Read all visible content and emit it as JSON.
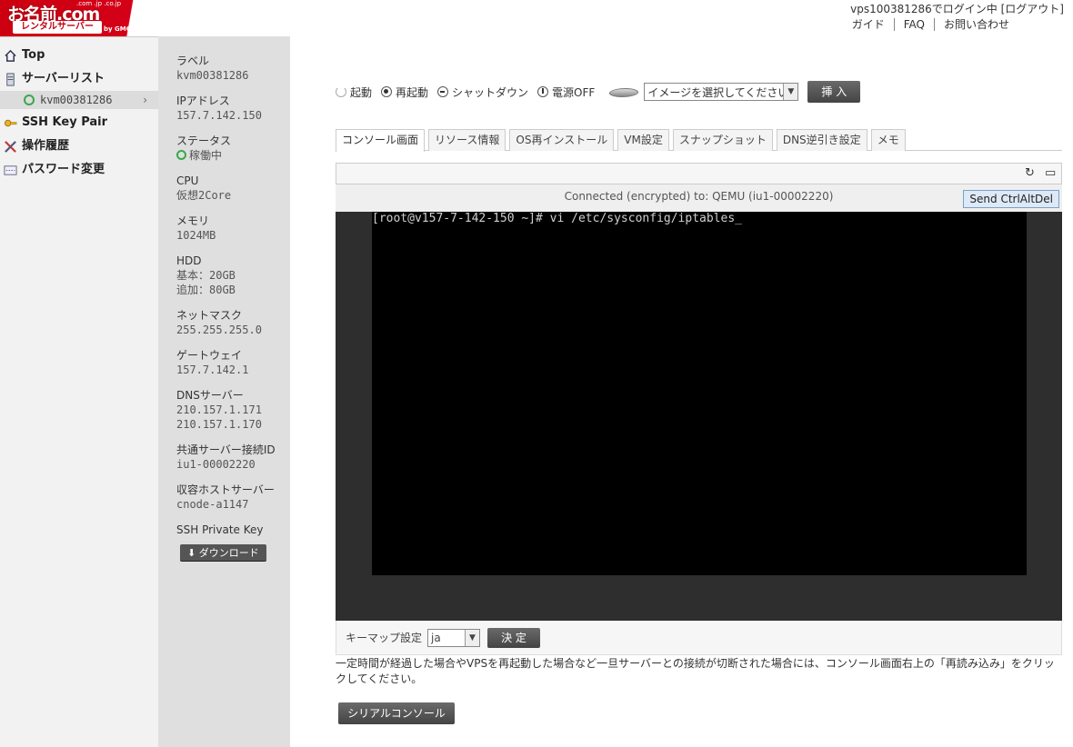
{
  "header": {
    "logo_main": "お名前.com",
    "logo_sub": "レンタルサーバー",
    "logo_by": "by GMO",
    "logo_domains": ".com .jp .co.jp",
    "login_status": "vps100381286でログイン中 [ログアウト]",
    "links": [
      "ガイド",
      "FAQ",
      "お問い合わせ"
    ]
  },
  "sidebar": {
    "items": [
      {
        "label": "Top",
        "icon": "home-icon"
      },
      {
        "label": "サーバーリスト",
        "icon": "server-icon"
      },
      {
        "label": "SSH Key Pair",
        "icon": "key-icon"
      },
      {
        "label": "操作履歴",
        "icon": "tools-icon"
      },
      {
        "label": "パスワード変更",
        "icon": "password-icon"
      }
    ],
    "server_entry": "kvm00381286"
  },
  "info": {
    "label_k": "ラベル",
    "label_v": "kvm00381286",
    "ip_k": "IPアドレス",
    "ip_v": "157.7.142.150",
    "status_k": "ステータス",
    "status_v": "稼働中",
    "cpu_k": "CPU",
    "cpu_v": "仮想2Core",
    "mem_k": "メモリ",
    "mem_v": "1024MB",
    "hdd_k": "HDD",
    "hdd_v1": "基本：20GB",
    "hdd_v2": "追加：80GB",
    "mask_k": "ネットマスク",
    "mask_v": "255.255.255.0",
    "gw_k": "ゲートウェイ",
    "gw_v": "157.7.142.1",
    "dns_k": "DNSサーバー",
    "dns_v1": "210.157.1.171",
    "dns_v2": "210.157.1.170",
    "shared_k": "共通サーバー接続ID",
    "shared_v": "iu1-00002220",
    "host_k": "収容ホストサーバー",
    "host_v": "cnode-a1147",
    "ssh_k": "SSH Private Key",
    "download": "ダウンロード"
  },
  "controls": {
    "start": "起動",
    "restart": "再起動",
    "shutdown": "シャットダウン",
    "poweroff": "電源OFF",
    "image_select": "イメージを選択してください",
    "insert": "挿 入"
  },
  "tabs": [
    "コンソール画面",
    "リソース情報",
    "OS再インストール",
    "VM設定",
    "スナップショット",
    "DNS逆引き設定",
    "メモ"
  ],
  "console": {
    "status": "Connected (encrypted) to: QEMU (iu1-00002220)",
    "send_cad": "Send CtrlAltDel",
    "terminal_line": "[root@v157-7-142-150 ~]# vi /etc/sysconfig/iptables_"
  },
  "keymap": {
    "label": "キーマップ設定",
    "value": "ja",
    "submit": "決 定"
  },
  "note": "一定時間が経過した場合やVPSを再起動した場合など一旦サーバーとの接続が切断された場合には、コンソール画面右上の「再読み込み」をクリックしてください。",
  "serial_button": "シリアルコンソール"
}
